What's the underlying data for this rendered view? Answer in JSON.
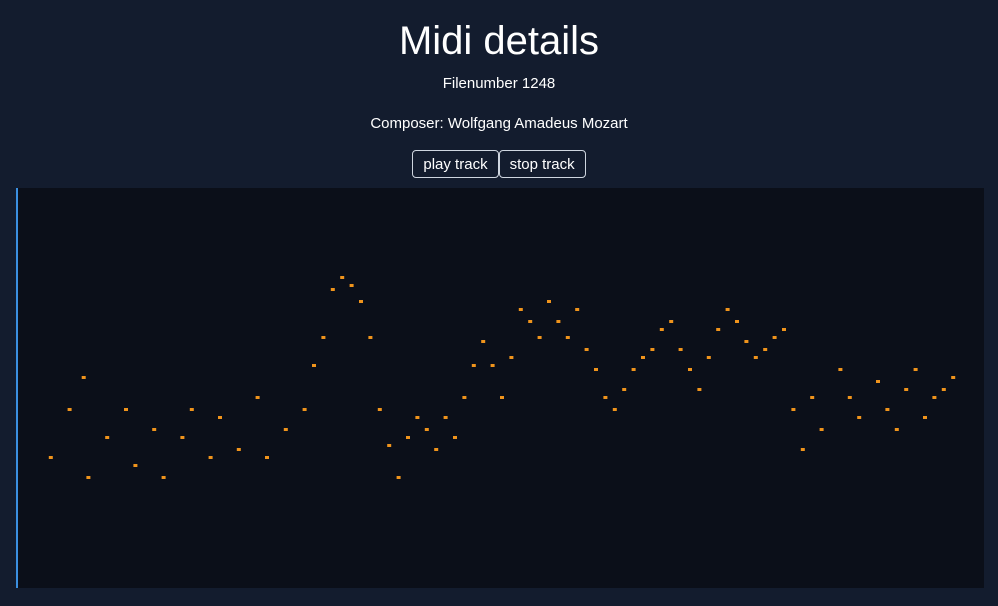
{
  "page": {
    "title": "Midi details",
    "file_number": "Filenumber 1248",
    "composer": "Composer: Wolfgang Amadeus Mozart"
  },
  "controls": {
    "play_label": "play track",
    "stop_label": "stop track"
  },
  "colors": {
    "background": "#131c2e",
    "roll_background": "#0b0f19",
    "note": "#f0941c",
    "playhead": "#3b8fe0"
  },
  "piano_roll": {
    "playhead_position": 0,
    "notes": [
      [
        0.02,
        0.67
      ],
      [
        0.04,
        0.55
      ],
      [
        0.055,
        0.47
      ],
      [
        0.06,
        0.72
      ],
      [
        0.08,
        0.62
      ],
      [
        0.1,
        0.55
      ],
      [
        0.11,
        0.69
      ],
      [
        0.13,
        0.6
      ],
      [
        0.14,
        0.72
      ],
      [
        0.16,
        0.62
      ],
      [
        0.17,
        0.55
      ],
      [
        0.19,
        0.67
      ],
      [
        0.2,
        0.57
      ],
      [
        0.22,
        0.65
      ],
      [
        0.24,
        0.52
      ],
      [
        0.25,
        0.67
      ],
      [
        0.27,
        0.6
      ],
      [
        0.29,
        0.55
      ],
      [
        0.3,
        0.44
      ],
      [
        0.31,
        0.37
      ],
      [
        0.32,
        0.25
      ],
      [
        0.33,
        0.22
      ],
      [
        0.34,
        0.24
      ],
      [
        0.35,
        0.28
      ],
      [
        0.36,
        0.37
      ],
      [
        0.37,
        0.55
      ],
      [
        0.38,
        0.64
      ],
      [
        0.39,
        0.72
      ],
      [
        0.4,
        0.62
      ],
      [
        0.41,
        0.57
      ],
      [
        0.42,
        0.6
      ],
      [
        0.43,
        0.65
      ],
      [
        0.44,
        0.57
      ],
      [
        0.45,
        0.62
      ],
      [
        0.46,
        0.52
      ],
      [
        0.47,
        0.44
      ],
      [
        0.48,
        0.38
      ],
      [
        0.49,
        0.44
      ],
      [
        0.5,
        0.52
      ],
      [
        0.51,
        0.42
      ],
      [
        0.52,
        0.3
      ],
      [
        0.53,
        0.33
      ],
      [
        0.54,
        0.37
      ],
      [
        0.55,
        0.28
      ],
      [
        0.56,
        0.33
      ],
      [
        0.57,
        0.37
      ],
      [
        0.58,
        0.3
      ],
      [
        0.59,
        0.4
      ],
      [
        0.6,
        0.45
      ],
      [
        0.61,
        0.52
      ],
      [
        0.62,
        0.55
      ],
      [
        0.63,
        0.5
      ],
      [
        0.64,
        0.45
      ],
      [
        0.65,
        0.42
      ],
      [
        0.66,
        0.4
      ],
      [
        0.67,
        0.35
      ],
      [
        0.68,
        0.33
      ],
      [
        0.69,
        0.4
      ],
      [
        0.7,
        0.45
      ],
      [
        0.71,
        0.5
      ],
      [
        0.72,
        0.42
      ],
      [
        0.73,
        0.35
      ],
      [
        0.74,
        0.3
      ],
      [
        0.75,
        0.33
      ],
      [
        0.76,
        0.38
      ],
      [
        0.77,
        0.42
      ],
      [
        0.78,
        0.4
      ],
      [
        0.79,
        0.37
      ],
      [
        0.8,
        0.35
      ],
      [
        0.81,
        0.55
      ],
      [
        0.82,
        0.65
      ],
      [
        0.83,
        0.52
      ],
      [
        0.84,
        0.6
      ],
      [
        0.86,
        0.45
      ],
      [
        0.87,
        0.52
      ],
      [
        0.88,
        0.57
      ],
      [
        0.9,
        0.48
      ],
      [
        0.91,
        0.55
      ],
      [
        0.92,
        0.6
      ],
      [
        0.93,
        0.5
      ],
      [
        0.94,
        0.45
      ],
      [
        0.95,
        0.57
      ],
      [
        0.96,
        0.52
      ],
      [
        0.97,
        0.5
      ],
      [
        0.98,
        0.47
      ]
    ]
  }
}
